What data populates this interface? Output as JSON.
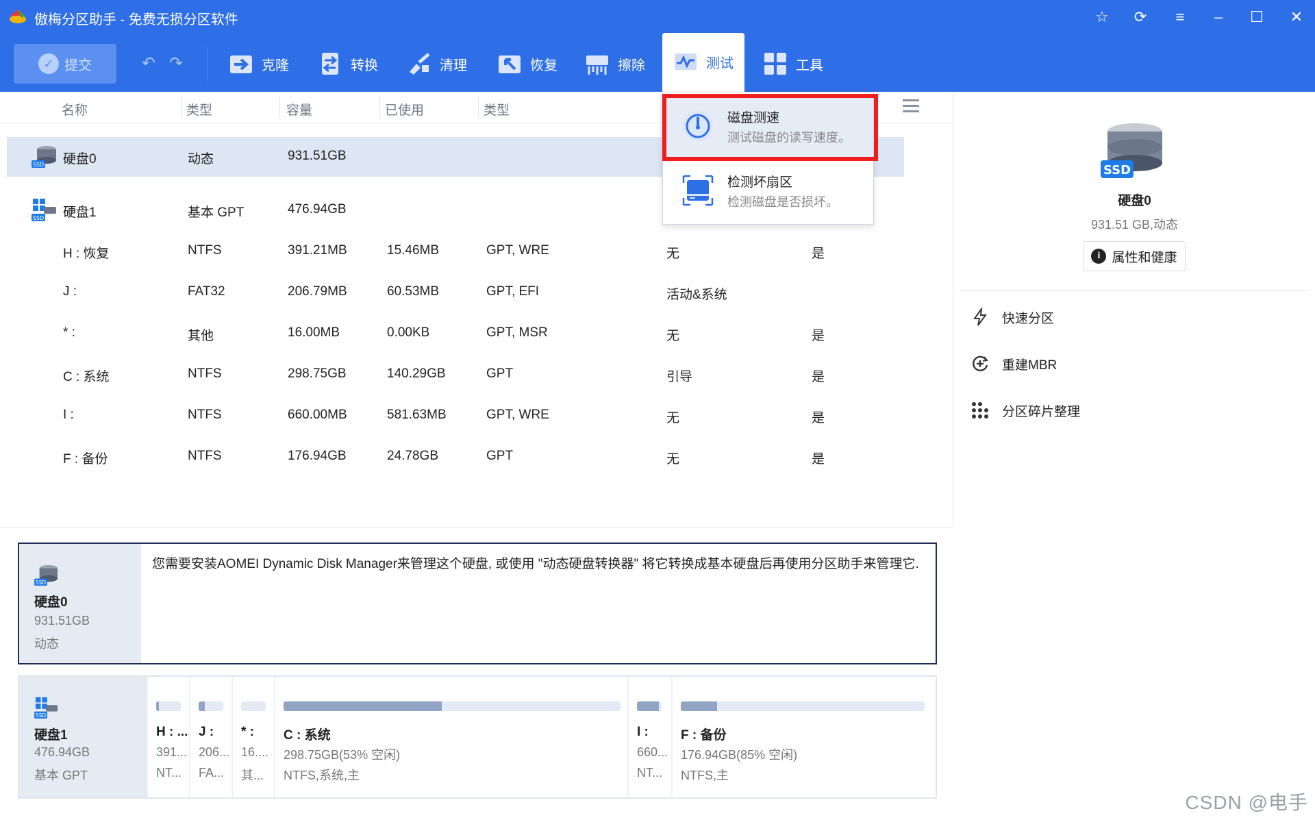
{
  "window": {
    "title": "傲梅分区助手 - 免费无损分区软件"
  },
  "toolbar": {
    "submit_label": "提交",
    "tools": [
      {
        "label": "克隆",
        "icon": "clone-icon"
      },
      {
        "label": "转换",
        "icon": "convert-icon"
      },
      {
        "label": "清理",
        "icon": "clean-icon"
      },
      {
        "label": "恢复",
        "icon": "restore-icon"
      },
      {
        "label": "擦除",
        "icon": "wipe-icon"
      }
    ],
    "active_tool": {
      "label": "测试",
      "icon": "test-icon"
    },
    "last_tool": {
      "label": "工具",
      "icon": "tools-icon"
    }
  },
  "columns": [
    "名称",
    "类型",
    "容量",
    "已使用",
    "类型"
  ],
  "disks": [
    {
      "name": "硬盘0",
      "type": "动态",
      "capacity": "931.51GB"
    },
    {
      "name": "硬盘1",
      "type": "基本 GPT",
      "capacity": "476.94GB"
    }
  ],
  "partitions": [
    {
      "name": "H : 恢复",
      "fs": "NTFS",
      "capacity": "391.21MB",
      "used": "15.46MB",
      "ptype": "GPT, WRE",
      "status": "无",
      "flag": "是"
    },
    {
      "name": "J :",
      "fs": "FAT32",
      "capacity": "206.79MB",
      "used": "60.53MB",
      "ptype": "GPT, EFI",
      "status": "活动&系统",
      "flag": ""
    },
    {
      "name": "* :",
      "fs": "其他",
      "capacity": "16.00MB",
      "used": "0.00KB",
      "ptype": "GPT, MSR",
      "status": "无",
      "flag": "是"
    },
    {
      "name": "C : 系统",
      "fs": "NTFS",
      "capacity": "298.75GB",
      "used": "140.29GB",
      "ptype": "GPT",
      "status": "引导",
      "flag": "是"
    },
    {
      "name": "I :",
      "fs": "NTFS",
      "capacity": "660.00MB",
      "used": "581.63MB",
      "ptype": "GPT, WRE",
      "status": "无",
      "flag": "是"
    },
    {
      "name": "F : 备份",
      "fs": "NTFS",
      "capacity": "176.94GB",
      "used": "24.78GB",
      "ptype": "GPT",
      "status": "无",
      "flag": "是"
    }
  ],
  "dropdown": {
    "items": [
      {
        "title": "磁盘测速",
        "subtitle": "测试磁盘的读写速度。",
        "icon": "speed-gauge-icon"
      },
      {
        "title": "检测坏扇区",
        "subtitle": "检测磁盘是否损坏。",
        "icon": "bad-sector-icon"
      }
    ]
  },
  "info_panel": {
    "disk_name": "硬盘0",
    "disk_size": "931.51GB",
    "disk_type": "动态",
    "message": "您需要安装AOMEI Dynamic Disk Manager来管理这个硬盘, 或使用 \"动态硬盘转换器\" 将它转换成基本硬盘后再使用分区助手来管理它."
  },
  "disk_map": {
    "disk_name": "硬盘1",
    "disk_size": "476.94GB",
    "disk_type": "基本 GPT",
    "parts": [
      {
        "name": "H : ...",
        "size": "391...",
        "fs": "NT...",
        "used_fraction": 0.1
      },
      {
        "name": "J :",
        "size": "206...",
        "fs": "FA...",
        "used_fraction": 0.25
      },
      {
        "name": "* :",
        "size": "16....",
        "fs": "其...",
        "used_fraction": 0.0
      },
      {
        "name": "C : 系统",
        "size": "298.75GB(53% 空闲)",
        "fs": "NTFS,系统,主",
        "used_fraction": 0.47
      },
      {
        "name": "I :",
        "size": "660...",
        "fs": "NT...",
        "used_fraction": 0.88
      },
      {
        "name": "F : 备份",
        "size": "176.94GB(85% 空闲)",
        "fs": "NTFS,主",
        "used_fraction": 0.15
      }
    ]
  },
  "right_panel": {
    "disk_name": "硬盘0",
    "disk_desc": "931.51 GB,动态",
    "props_label": "属性和健康",
    "actions": [
      {
        "label": "快速分区",
        "icon": "lightning-icon"
      },
      {
        "label": "重建MBR",
        "icon": "rebuild-icon"
      },
      {
        "label": "分区碎片整理",
        "icon": "defrag-icon"
      }
    ]
  },
  "watermark": "CSDN @电手",
  "colors": {
    "accent": "#2e6ee6",
    "highlight": "#ef1d1d",
    "selected_row": "#dde6f3"
  }
}
